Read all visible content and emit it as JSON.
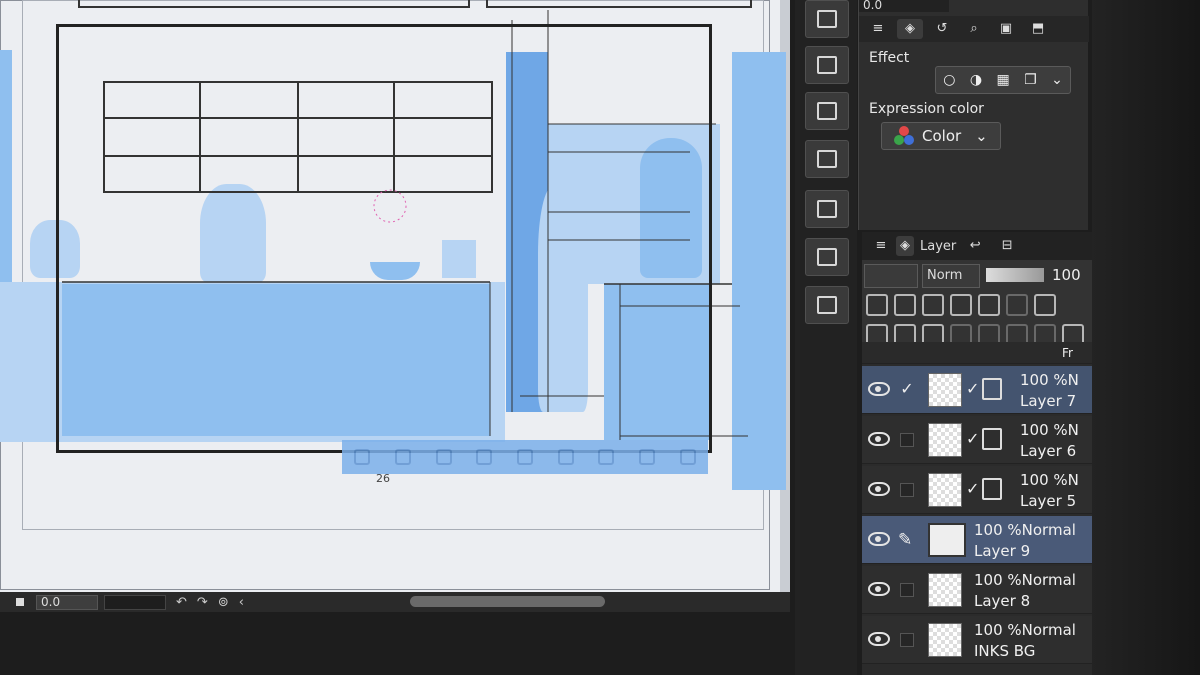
{
  "canvas": {
    "page_number": "26",
    "zoom_value": "0.0"
  },
  "properties": {
    "top_field": "0.0",
    "effect_label": "Effect",
    "expression_color_label": "Expression color",
    "expression_color_value": "Color"
  },
  "layer_panel": {
    "tab_label": "Layer",
    "mode_value": "Norm",
    "opacity_value": "100",
    "layers": [
      {
        "opacity": "100 %N",
        "name": "Layer 7",
        "visible": true,
        "checked": true,
        "selected": true
      },
      {
        "opacity": "100 %N",
        "name": "Layer 6",
        "visible": true,
        "checked": false,
        "selected": false
      },
      {
        "opacity": "100 %N",
        "name": "Layer 5",
        "visible": true,
        "checked": false,
        "selected": false
      },
      {
        "opacity": "100 %Normal",
        "name": "Layer 9",
        "visible": true,
        "checked": false,
        "selected": true
      },
      {
        "opacity": "100 %Normal",
        "name": "Layer 8",
        "visible": true,
        "checked": false,
        "selected": false
      },
      {
        "opacity": "100 %Normal",
        "name": "INKS BG",
        "visible": true,
        "checked": false,
        "selected": false
      }
    ],
    "folder_row_label": "Fr"
  },
  "colors": {
    "canvas_blue": "#8fbfef",
    "selected_layer": "#44546f",
    "panel_bg": "#2e2e2e"
  }
}
